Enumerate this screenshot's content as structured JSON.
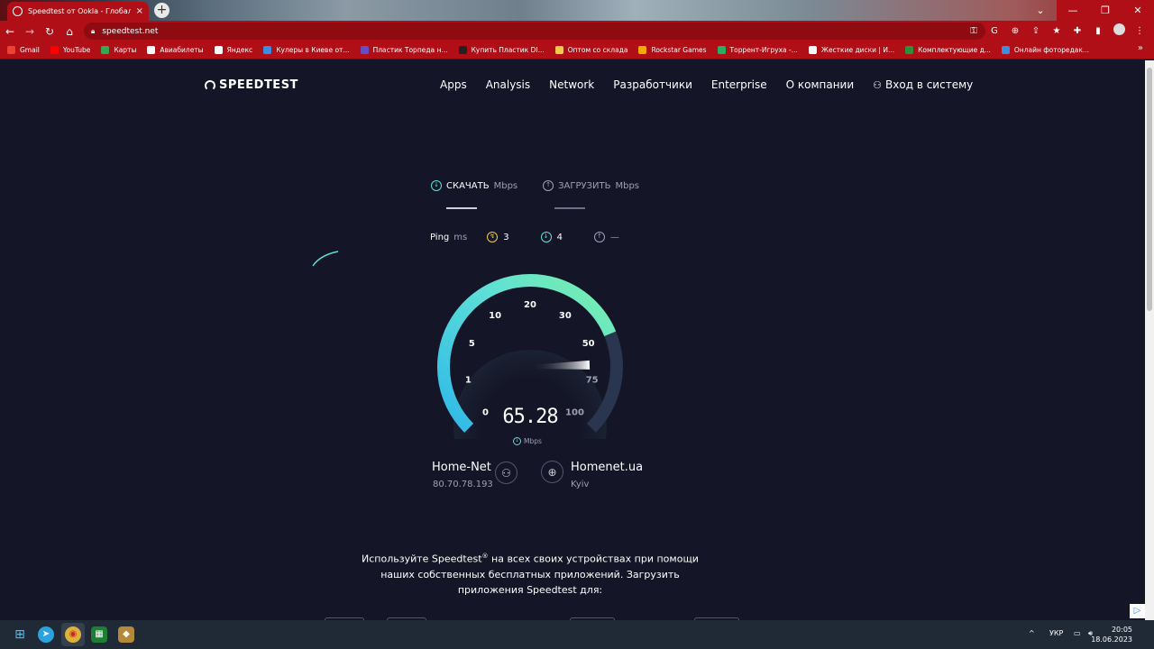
{
  "browser": {
    "tab_title": "Speedtest от Ookla - Глобальный",
    "url": "speedtest.net",
    "bookmarks": [
      {
        "label": "Gmail",
        "color": "#ea4335"
      },
      {
        "label": "YouTube",
        "color": "#ff0000"
      },
      {
        "label": "Карты",
        "color": "#34a853"
      },
      {
        "label": "Авиабилеты",
        "color": "#ffffff"
      },
      {
        "label": "Яндекс",
        "color": "#ffffff"
      },
      {
        "label": "Кулеры в Киеве от...",
        "color": "#3a8de0"
      },
      {
        "label": "Пластик Торпеда н...",
        "color": "#6a4cc2"
      },
      {
        "label": "Купить Пластик DI...",
        "color": "#222222"
      },
      {
        "label": "Оптом со склада",
        "color": "#f2c94c"
      },
      {
        "label": "Rockstar Games",
        "color": "#f2a900"
      },
      {
        "label": "Торрент-Игруха -...",
        "color": "#27ae60"
      },
      {
        "label": "Жесткие диски | И...",
        "color": "#ffffff"
      },
      {
        "label": "Комплектующие д...",
        "color": "#2d8f3c"
      },
      {
        "label": "Онлайн фоторедак...",
        "color": "#3a8de0"
      }
    ]
  },
  "site": {
    "logo": "SPEEDTEST",
    "nav": [
      "Apps",
      "Analysis",
      "Network",
      "Разработчики",
      "Enterprise",
      "О компании"
    ],
    "login": "Вход в систему"
  },
  "test": {
    "download_label": "СКАЧАТЬ",
    "download_unit": "Mbps",
    "upload_label": "ЗАГРУЗИТЬ",
    "upload_unit": "Mbps",
    "ping_label": "Ping",
    "ping_unit": "ms",
    "jitter": "3",
    "ping_down": "4",
    "ping_up": "—",
    "speed": "65.28",
    "speed_unit": "Mbps",
    "gauge_ticks": [
      "0",
      "1",
      "5",
      "10",
      "20",
      "30",
      "50",
      "75",
      "100"
    ],
    "gauge_max": 100,
    "accent_color": "#5ee0d6"
  },
  "connection": {
    "isp_name": "Home-Net",
    "isp_ip": "80.70.78.193",
    "server_name": "Homenet.ua",
    "server_city": "Kyiv"
  },
  "promo": {
    "line1a": "Используйте Speedtest",
    "reg": "®",
    "line1b": " на всех своих устройствах при помощи",
    "line2": "наших собственных бесплатных приложений. Загрузить",
    "line3": "приложения Speedtest для:"
  },
  "taskbar": {
    "lang": "УКР",
    "time": "20:05",
    "date": "18.06.2023"
  }
}
